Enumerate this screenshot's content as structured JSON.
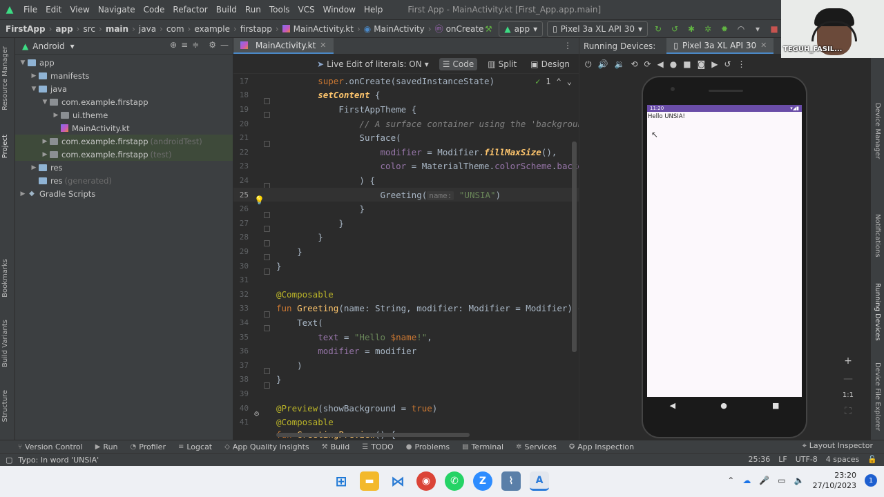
{
  "menubar": {
    "items": [
      "File",
      "Edit",
      "View",
      "Navigate",
      "Code",
      "Refactor",
      "Build",
      "Run",
      "Tools",
      "VCS",
      "Window",
      "Help"
    ],
    "window_title": "First App - MainActivity.kt [First_App.app.main]"
  },
  "breadcrumb": [
    "FirstApp",
    "app",
    "src",
    "main",
    "java",
    "com",
    "example",
    "firstapp",
    "MainActivity.kt",
    "MainActivity",
    "onCreate"
  ],
  "toolbar": {
    "run_config": "app",
    "device": "Pixel 3a XL API 30"
  },
  "left_strip": [
    "Resource Manager",
    "Project",
    "Bookmarks",
    "Build Variants",
    "Structure"
  ],
  "right_strip": [
    "Device Manager",
    "Notifications",
    "Running Devices",
    "Device File Explorer"
  ],
  "project": {
    "view": "Android",
    "tree": [
      {
        "label": "app",
        "suffix": "",
        "icon": "folder-icon"
      },
      {
        "label": "manifests",
        "suffix": "",
        "icon": "folder-icon"
      },
      {
        "label": "java",
        "suffix": "",
        "icon": "folder-icon"
      },
      {
        "label": "com.example.firstapp",
        "suffix": "",
        "icon": "package-icon"
      },
      {
        "label": "ui.theme",
        "suffix": "",
        "icon": "package-icon"
      },
      {
        "label": "MainActivity.kt",
        "suffix": "",
        "icon": "kotlin-file-icon"
      },
      {
        "label": "com.example.firstapp",
        "suffix": "(androidTest)",
        "icon": "package-icon"
      },
      {
        "label": "com.example.firstapp",
        "suffix": "(test)",
        "icon": "package-icon"
      },
      {
        "label": "res",
        "suffix": "",
        "icon": "folder-icon"
      },
      {
        "label": "res",
        "suffix": "(generated)",
        "icon": "folder-icon"
      },
      {
        "label": "Gradle Scripts",
        "suffix": "",
        "icon": "gradle-icon"
      }
    ]
  },
  "editor": {
    "tab": "MainActivity.kt",
    "live_edit": "Live Edit of literals: ON",
    "modes": [
      "Code",
      "Split",
      "Design"
    ],
    "inspection_count": "1",
    "lines": [
      "17",
      "18",
      "19",
      "20",
      "21",
      "22",
      "23",
      "24",
      "25",
      "26",
      "27",
      "28",
      "29",
      "30",
      "31",
      "32",
      "33",
      "34",
      "35",
      "36",
      "37",
      "38",
      "39",
      "40",
      "41"
    ],
    "code": {
      "l17a": "super",
      "l17b": ".onCreate(savedInstanceState)",
      "l18a": "setContent",
      "l18b": " {",
      "l19a": "FirstAppTheme",
      "l19b": " {",
      "l20": "// A surface container using the 'background' color from the theme",
      "l21": "Surface(",
      "l22a": "modifier",
      "l22b": " = Modifier.",
      "l22c": "fillMaxSize",
      "l22d": "(),",
      "l23a": "color",
      "l23b": " = MaterialTheme.",
      "l23c": "colorScheme",
      "l23d": ".",
      "l23e": "background",
      "l24": ") {",
      "l25a": "Greeting(",
      "l25hint": "name:",
      "l25b": "\"UNSIA\"",
      "l25c": ")",
      "l26": "}",
      "l27": "}",
      "l28": "}",
      "l29": "}",
      "l30": "}",
      "l32": "@Composable",
      "l33a": "fun ",
      "l33b": "Greeting",
      "l33c": "(name: String, modifier: Modifier = Modifier) {",
      "l34": "Text(",
      "l35a": "text",
      "l35b": " = ",
      "l35c": "\"Hello ",
      "l35d": "$name",
      "l35e": "!\"",
      "l35f": ",",
      "l36a": "modifier",
      "l36b": " = modifier",
      "l37": ")",
      "l38": "}",
      "l40a": "@Preview",
      "l40b": "(showBackground = ",
      "l40c": "true",
      "l40d": ")",
      "l41": "@Composable",
      "l42a": "fun ",
      "l42b": "GreetingPreview",
      "l42c": "() {"
    }
  },
  "running_devices": {
    "label": "Running Devices:",
    "tab": "Pixel 3a XL API 30",
    "status_time": "11:20",
    "screen_text": "Hello UNSIA!"
  },
  "bottom_tools": [
    "Version Control",
    "Run",
    "Profiler",
    "Logcat",
    "App Quality Insights",
    "Build",
    "TODO",
    "Problems",
    "Terminal",
    "Services",
    "App Inspection"
  ],
  "layout_inspector": "Layout Inspector",
  "statusbar": {
    "message": "Typo: In word 'UNSIA'",
    "position": "25:36",
    "line_sep": "LF",
    "encoding": "UTF-8",
    "indent": "4 spaces"
  },
  "taskbar": {
    "time": "23:20",
    "date": "27/10/2023",
    "notif_count": "1"
  },
  "webcam": {
    "name": "TEGUH_FASIL..."
  }
}
